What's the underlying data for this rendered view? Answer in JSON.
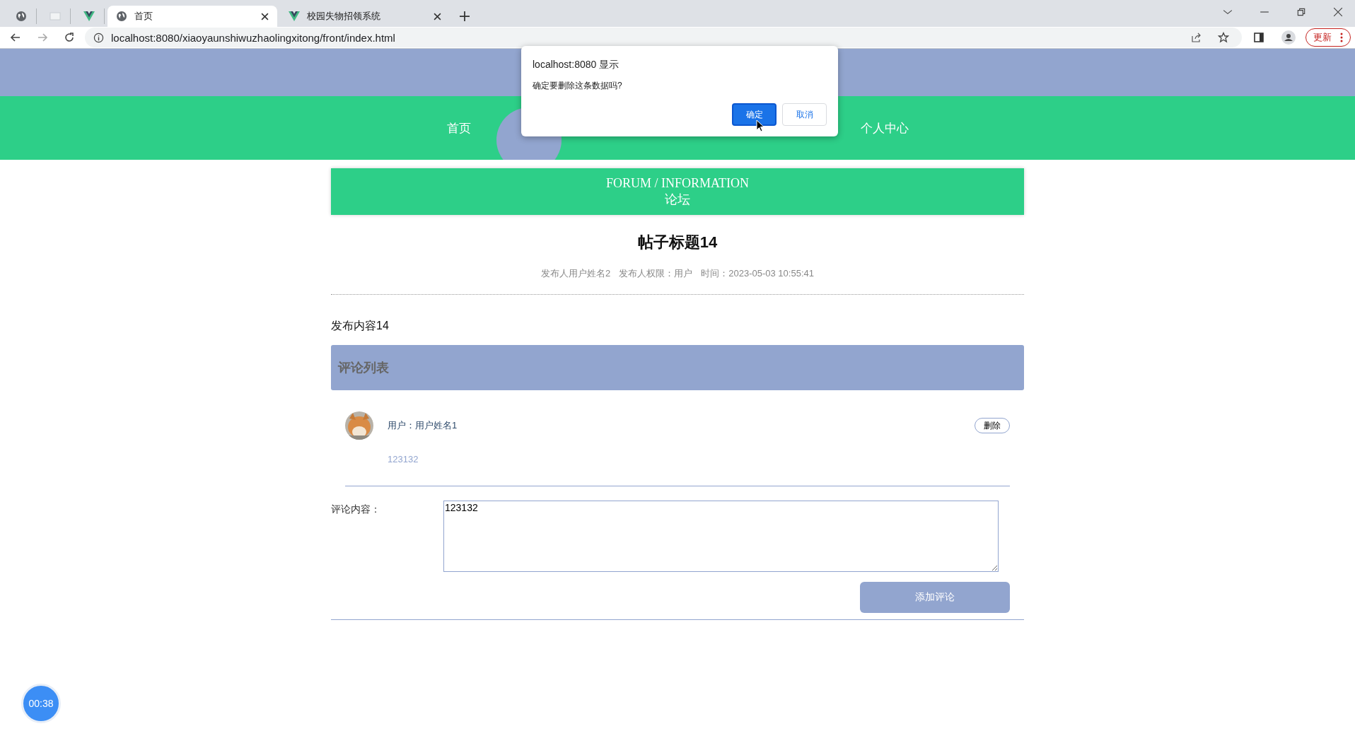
{
  "browser": {
    "tabs": [
      {
        "kind": "globe",
        "selected": false
      },
      {
        "kind": "blank",
        "selected": false
      },
      {
        "kind": "vue",
        "selected": false
      },
      {
        "kind": "globe",
        "title": "首页",
        "selected": true
      },
      {
        "kind": "vue",
        "title": "校园失物招领系统",
        "selected": false
      }
    ],
    "address": "localhost:8080/xiaoyaunshiwuzhaolingxitong/front/index.html",
    "update_button": "更新"
  },
  "nav": {
    "items": [
      {
        "label": "首页"
      },
      {
        "label": "个人中心"
      }
    ]
  },
  "dialog": {
    "title": "localhost:8080 显示",
    "message": "确定要删除这条数据吗?",
    "buttons": [
      {
        "label": "确定",
        "kind": "primary"
      },
      {
        "label": "取消",
        "kind": "secondary"
      }
    ]
  },
  "banner": {
    "english": "FORUM / INFORMATION",
    "chinese": "论坛"
  },
  "post": {
    "title": "帖子标题14",
    "meta": [
      "发布人用户姓名2",
      "发布人权限：用户",
      "时间：2023-05-03 10:55:41"
    ],
    "content": "发布内容14"
  },
  "comments": {
    "heading": "评论列表",
    "items": [
      {
        "user": "用户：用户姓名1",
        "text": "123132",
        "delete": "删除"
      }
    ]
  },
  "form": {
    "label": "评论内容：",
    "value": "123132",
    "submit": "添加评论"
  },
  "timer": "00:38"
}
